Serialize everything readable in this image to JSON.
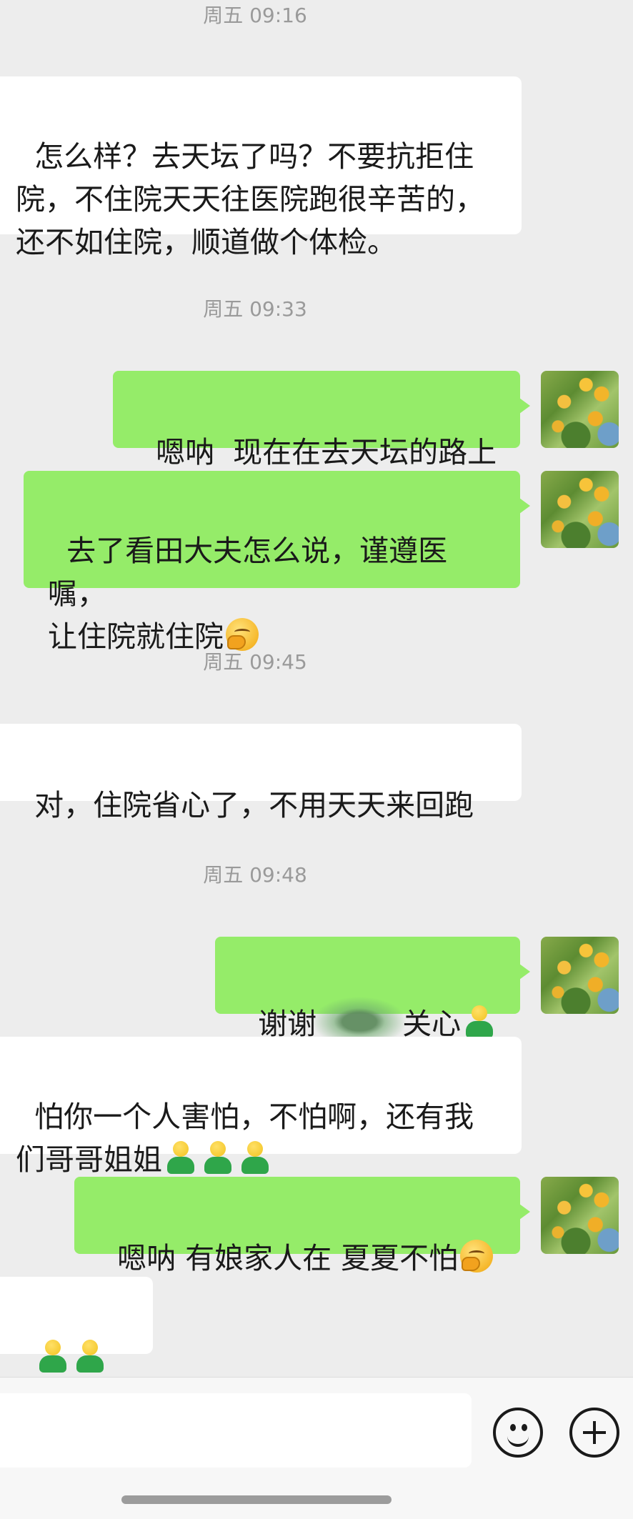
{
  "timestamps": [
    "周五 09:16",
    "周五 09:33",
    "周五 09:45",
    "周五 09:48"
  ],
  "messages": {
    "m1": "怎么样？去天坛了吗？不要抗拒住\n院，不住院天天往医院跑很辛苦的，\n还不如住院，顺道做个体检。",
    "m2": "嗯呐  现在在去天坛的路上",
    "m3a": "去了看田大夫怎么说，谨遵医嘱，\n让住院就住院",
    "m4": "对，住院省心了，不用天天来回跑",
    "m5a": "谢谢",
    "m5b": "关心",
    "m6a": "怕你一个人害怕，不怕啊，还有我\n们哥哥姐姐",
    "m7a": "嗯呐 有娘家人在 夏夏不怕"
  },
  "emoji": {
    "thinking": "hand-over-mouth-emoji",
    "person": "green-person-emoji"
  },
  "colors": {
    "background": "#ededed",
    "incoming_bubble": "#ffffff",
    "outgoing_bubble": "#95ec69"
  },
  "icons": {
    "emoji_button": "smile-icon",
    "more_button": "plus-icon"
  }
}
